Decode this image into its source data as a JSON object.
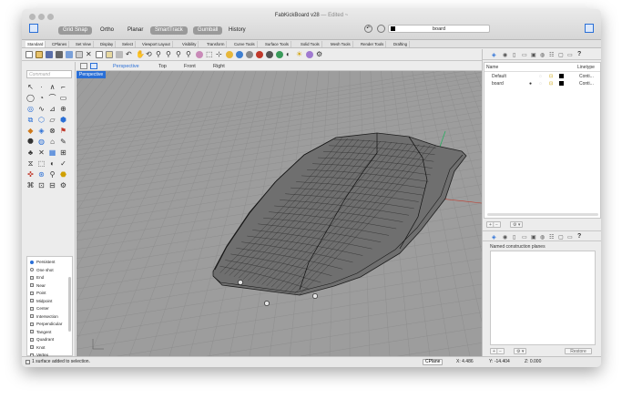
{
  "window": {
    "title": "FabKickBoard v28",
    "title_suffix": "— Edited ~"
  },
  "toolbar": {
    "modes": [
      {
        "label": "Grid Snap",
        "active": true
      },
      {
        "label": "Ortho",
        "active": false
      },
      {
        "label": "Planar",
        "active": false
      },
      {
        "label": "SmartTrack",
        "active": true
      },
      {
        "label": "Gumball",
        "active": true
      },
      {
        "label": "History",
        "active": false
      }
    ],
    "layer_field": "board"
  },
  "tabs": [
    "Standard",
    "CPlanes",
    "Set View",
    "Display",
    "Select",
    "Viewport Layout",
    "Visibility",
    "Transform",
    "Curve Tools",
    "Surface Tools",
    "Solid Tools",
    "Mesh Tools",
    "Render Tools",
    "Drafting"
  ],
  "command_placeholder": "Command",
  "viewport": {
    "tabs": [
      "Perspective",
      "Top",
      "Front",
      "Right"
    ],
    "active_label": "Perspective"
  },
  "osnap": {
    "modes": [
      {
        "label": "Persistent",
        "type": "radio"
      },
      {
        "label": "One shot",
        "type": "radio"
      },
      {
        "label": "End",
        "type": "check"
      },
      {
        "label": "Near",
        "type": "check"
      },
      {
        "label": "Point",
        "type": "check"
      },
      {
        "label": "Midpoint",
        "type": "check"
      },
      {
        "label": "Center",
        "type": "check"
      },
      {
        "label": "Intersection",
        "type": "check"
      },
      {
        "label": "Perpendicular",
        "type": "check"
      },
      {
        "label": "Tangent",
        "type": "check"
      },
      {
        "label": "Quadrant",
        "type": "check"
      },
      {
        "label": "Knot",
        "type": "check"
      },
      {
        "label": "Vertex",
        "type": "check"
      }
    ]
  },
  "layers": {
    "headers": {
      "name": "Name",
      "linetype": "Linetype"
    },
    "rows": [
      {
        "name": "Default",
        "linetype": "Conti...",
        "current": false
      },
      {
        "name": "board",
        "linetype": "Conti...",
        "current": true
      }
    ]
  },
  "named_cplanes": {
    "title": "Named construction planes",
    "restore_label": "Restore"
  },
  "status": {
    "message": "1 surface added to selection.",
    "cplane": "CPlane",
    "x": "X: 4.486",
    "y": "Y: -14.404",
    "z": "Z: 0.000"
  },
  "colors": {
    "accent": "#2a6fd6",
    "viewport_bg": "#9d9d9d",
    "grid": "#8a8a8a",
    "x_axis": "#c0392b",
    "y_axis": "#27ae60"
  }
}
